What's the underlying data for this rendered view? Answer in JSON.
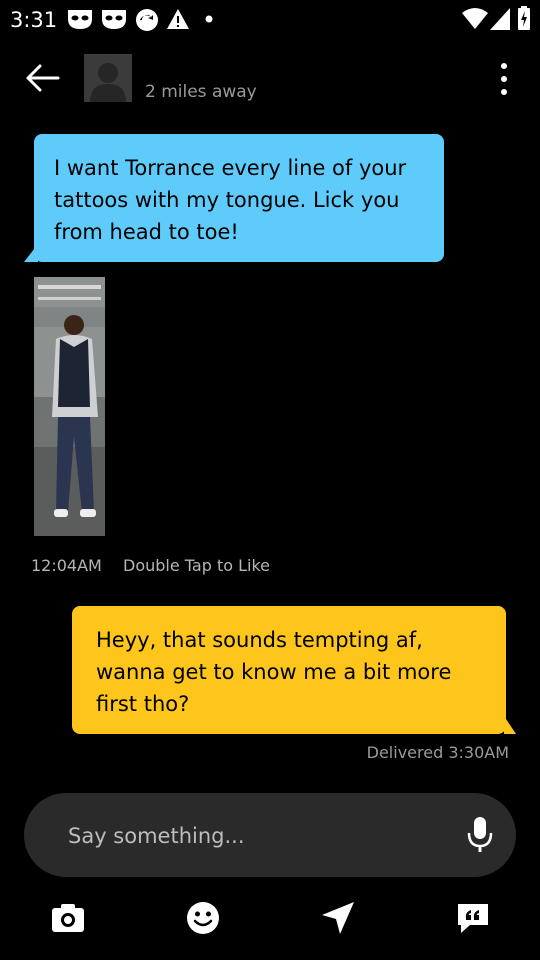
{
  "status_bar": {
    "time": "3:31"
  },
  "header": {
    "distance": "2 miles away"
  },
  "messages": {
    "incoming_text": "I want Torrance every line of your tattoos with my tongue. Lick you from head to toe!",
    "photo_time": "12:04AM",
    "photo_hint": "Double Tap to Like",
    "outgoing_text": "Heyy, that sounds tempting af, wanna get to know me a bit more first tho?",
    "status": "Delivered 3:30AM"
  },
  "composer": {
    "placeholder": "Say something..."
  },
  "colors": {
    "incoming_bubble": "#5ecbfb",
    "outgoing_bubble": "#fec61b",
    "background": "#000000"
  },
  "toolbar": {
    "icons": [
      "camera-icon",
      "emoji-icon",
      "location-icon",
      "quick-reply-icon"
    ]
  }
}
